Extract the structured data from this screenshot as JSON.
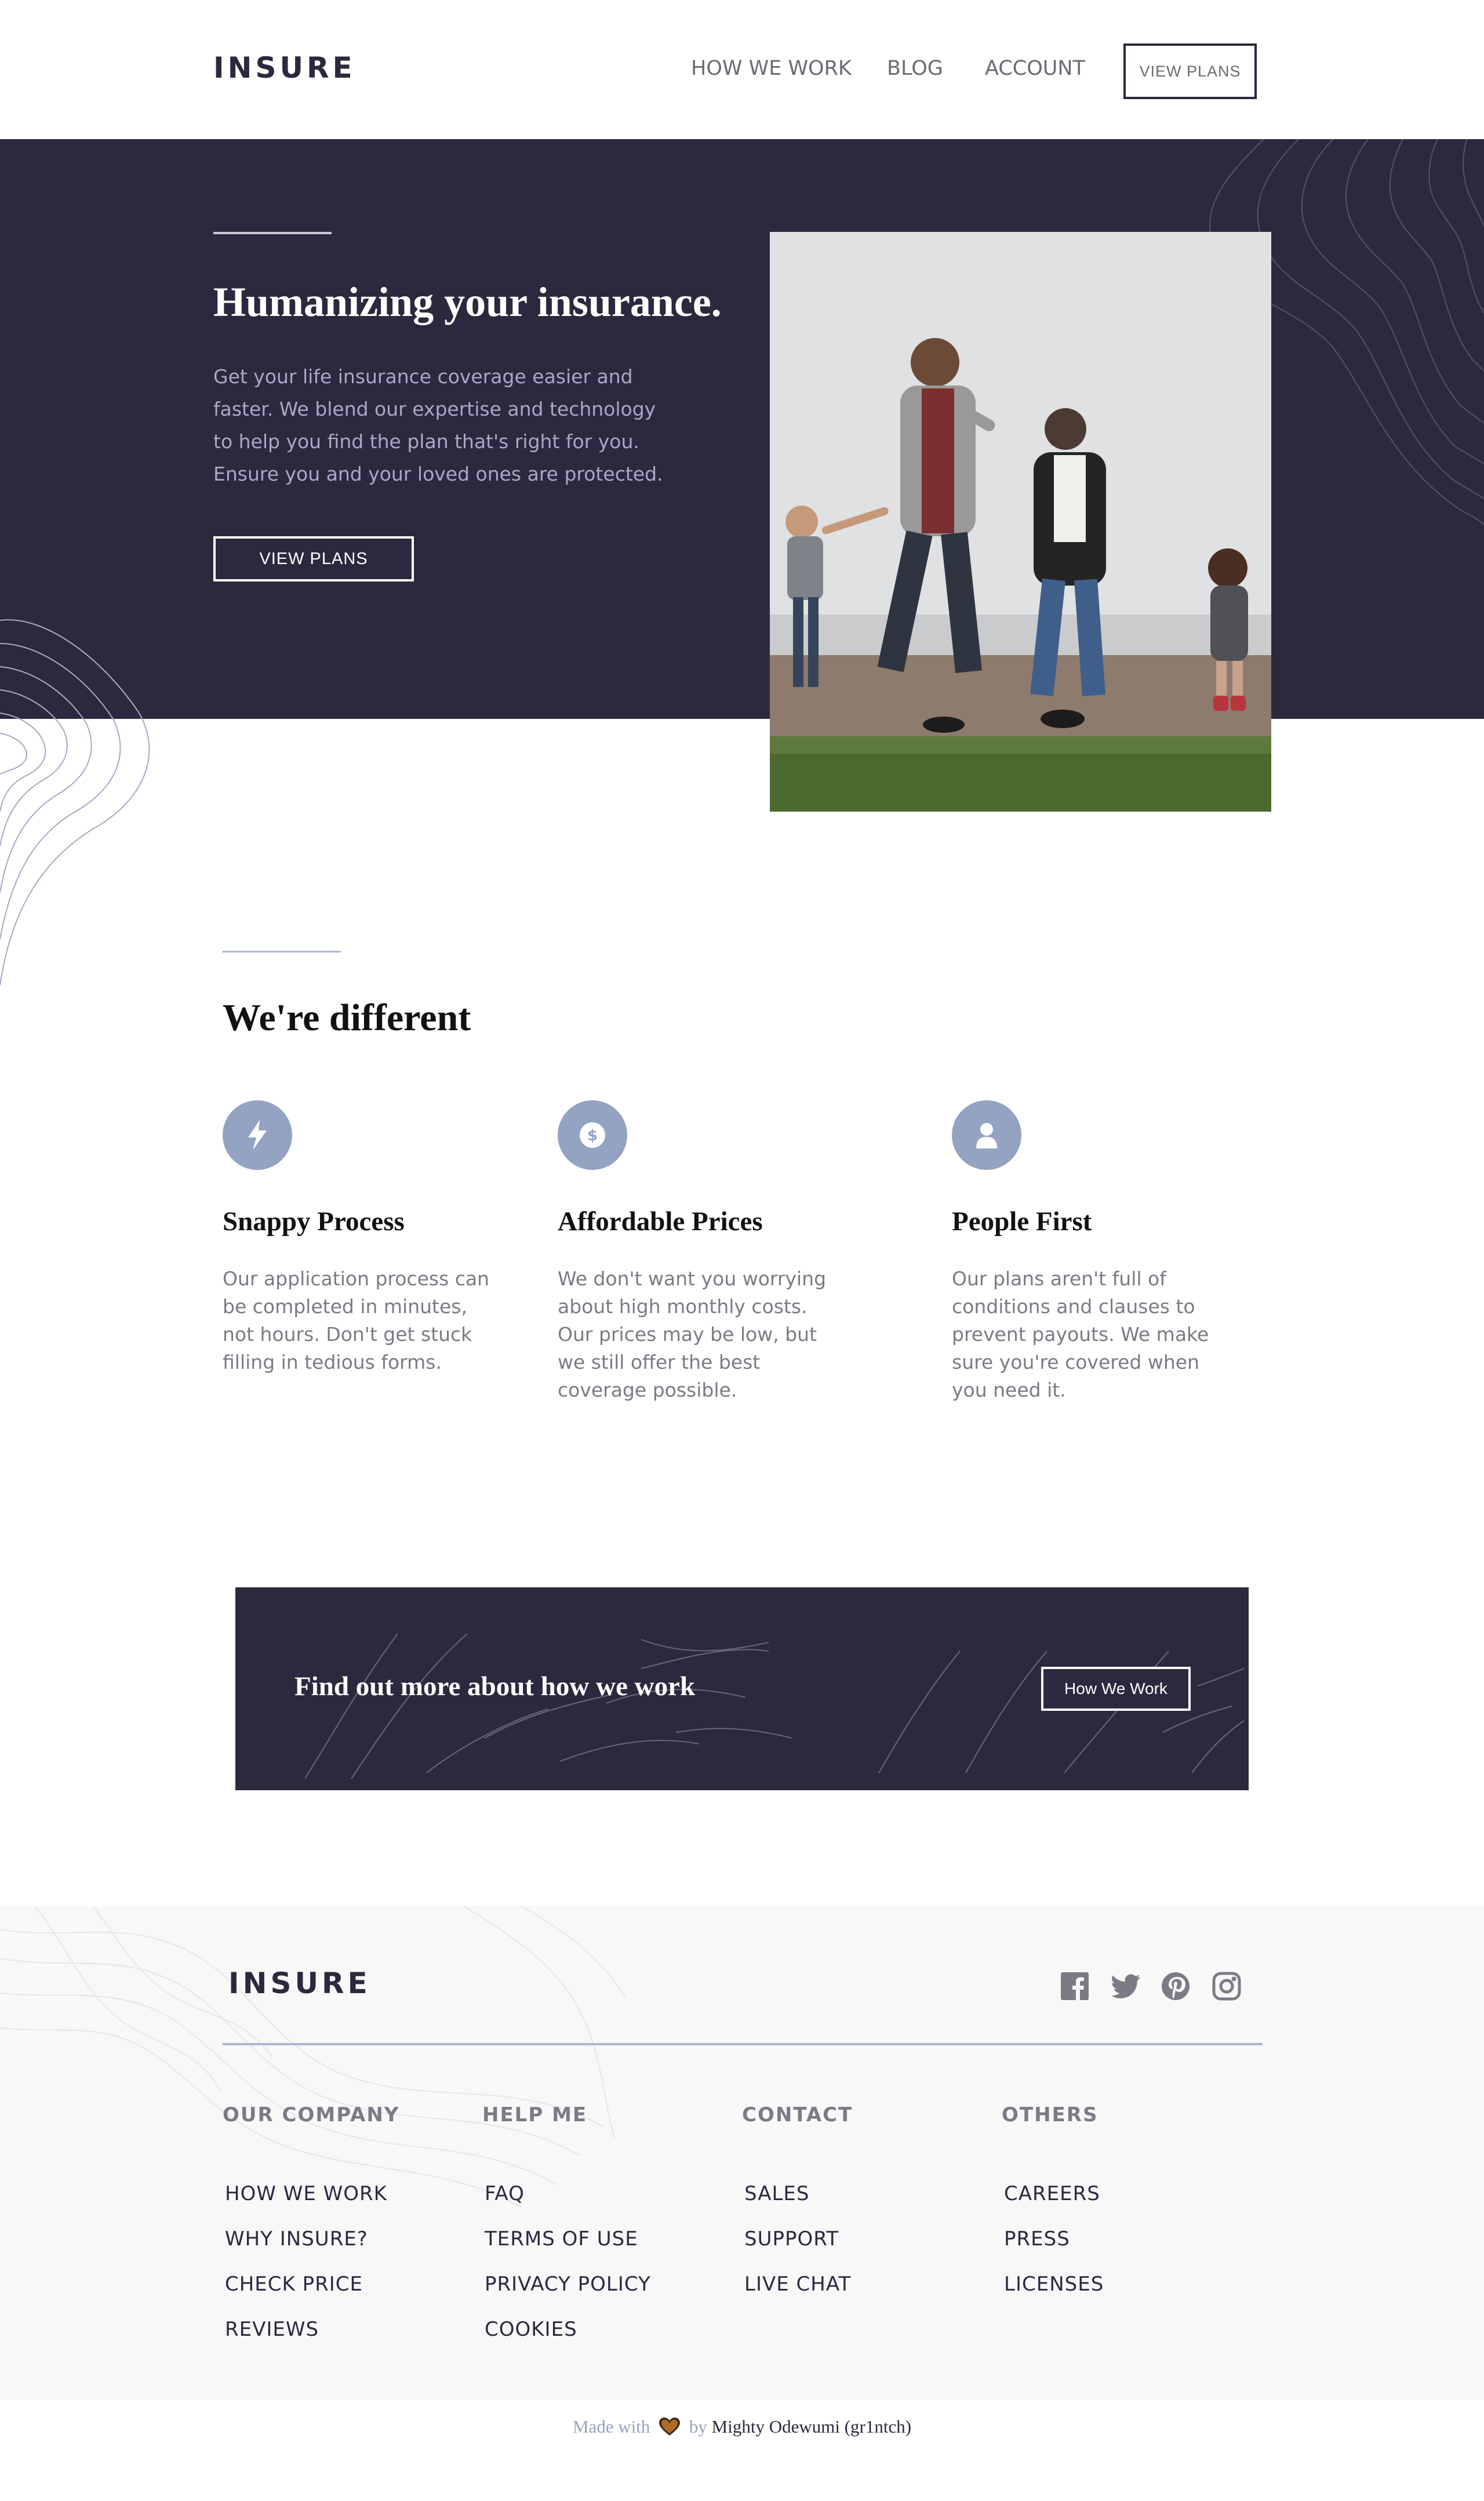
{
  "header": {
    "logo": "INSURE",
    "nav": [
      "HOW WE WORK",
      "BLOG",
      "ACCOUNT"
    ],
    "cta_label": "VIEW PLANS"
  },
  "hero": {
    "title": "Humanizing your insurance.",
    "description": "Get your life insurance coverage easier and faster. We blend our expertise and technology to help you find the plan that's right for you. Ensure you and your loved ones are protected.",
    "button_label": "VIEW PLANS"
  },
  "different": {
    "title": "We're different",
    "features": [
      {
        "icon": "lightning-icon",
        "title": "Snappy Process",
        "text": "Our application process can be completed in minutes, not hours. Don't get stuck filling in tedious forms."
      },
      {
        "icon": "dollar-icon",
        "title": "Affordable Prices",
        "text": "We don't want you worrying about high monthly costs. Our prices may be low, but we still offer the best coverage possible."
      },
      {
        "icon": "person-icon",
        "title": "People First",
        "text": "Our plans aren't full of conditions and clauses to prevent payouts. We make sure you're covered when you need it."
      }
    ]
  },
  "cta": {
    "text": "Find out more about how we work",
    "button_label": "How We Work"
  },
  "footer": {
    "logo": "INSURE",
    "social": [
      "facebook-icon",
      "twitter-icon",
      "pinterest-icon",
      "instagram-icon"
    ],
    "columns": [
      {
        "title": "OUR COMPANY",
        "links": [
          "HOW WE WORK",
          "WHY INSURE?",
          "CHECK PRICE",
          "REVIEWS"
        ]
      },
      {
        "title": "HELP ME",
        "links": [
          "FAQ",
          "TERMS OF USE",
          "PRIVACY POLICY",
          "COOKIES"
        ]
      },
      {
        "title": "CONTACT",
        "links": [
          "SALES",
          "SUPPORT",
          "LIVE CHAT"
        ]
      },
      {
        "title": "OTHERS",
        "links": [
          "CAREERS",
          "PRESS",
          "LICENSES"
        ]
      }
    ]
  },
  "credit": {
    "made_with": "Made with",
    "by": "by",
    "author": "Mighty Odewumi (gr1ntch)"
  },
  "colors": {
    "dark_violet": "#2d283e",
    "grayish_violet": "#6b6b74",
    "light_blue": "#94a3c2",
    "footer_bg": "#f8f8f8"
  }
}
